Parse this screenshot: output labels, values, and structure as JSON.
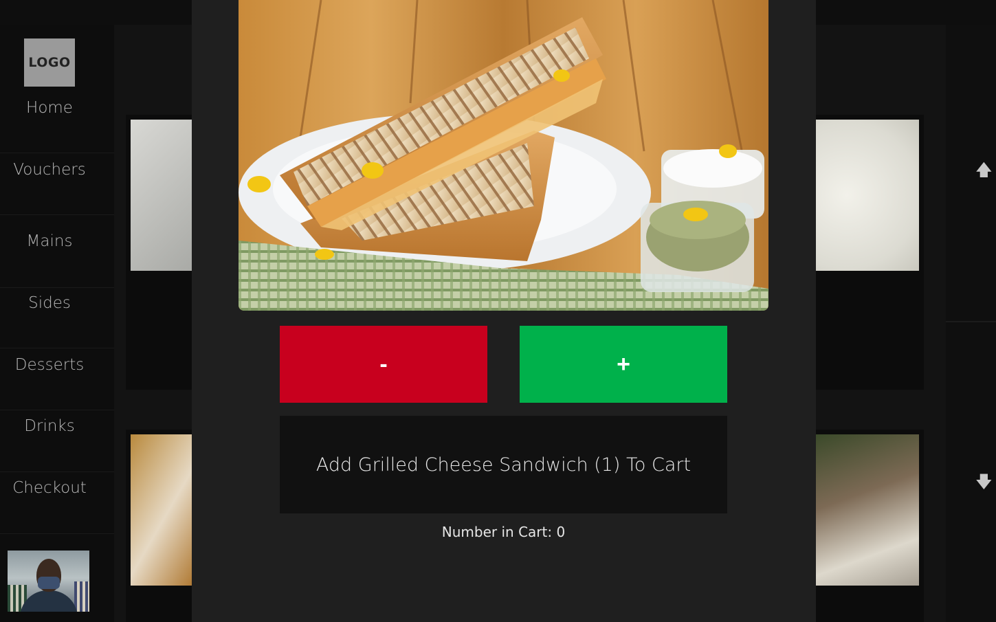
{
  "sidebar": {
    "logo_text": "LOGO",
    "items": [
      {
        "label": "Home"
      },
      {
        "label": "Vouchers"
      },
      {
        "label": "Mains"
      },
      {
        "label": "Sides"
      },
      {
        "label": "Desserts"
      },
      {
        "label": "Drinks"
      },
      {
        "label": "Checkout"
      }
    ]
  },
  "scroll": {
    "up_icon": "arrow-up-icon",
    "down_icon": "arrow-down-icon",
    "up_glyph": "🡅",
    "down_glyph": "🡇"
  },
  "modal": {
    "item_image": "grilled-cheese-sandwich-photo",
    "minus_label": "-",
    "plus_label": "+",
    "add_to_cart_label": "Add Grilled Cheese Sandwich (1) To Cart",
    "cart_count_text": "Number in Cart: 0"
  },
  "colors": {
    "minus": "#c8001e",
    "plus": "#00b14b",
    "modal_bg": "#1f1f1f",
    "add_button_bg": "#111111"
  }
}
